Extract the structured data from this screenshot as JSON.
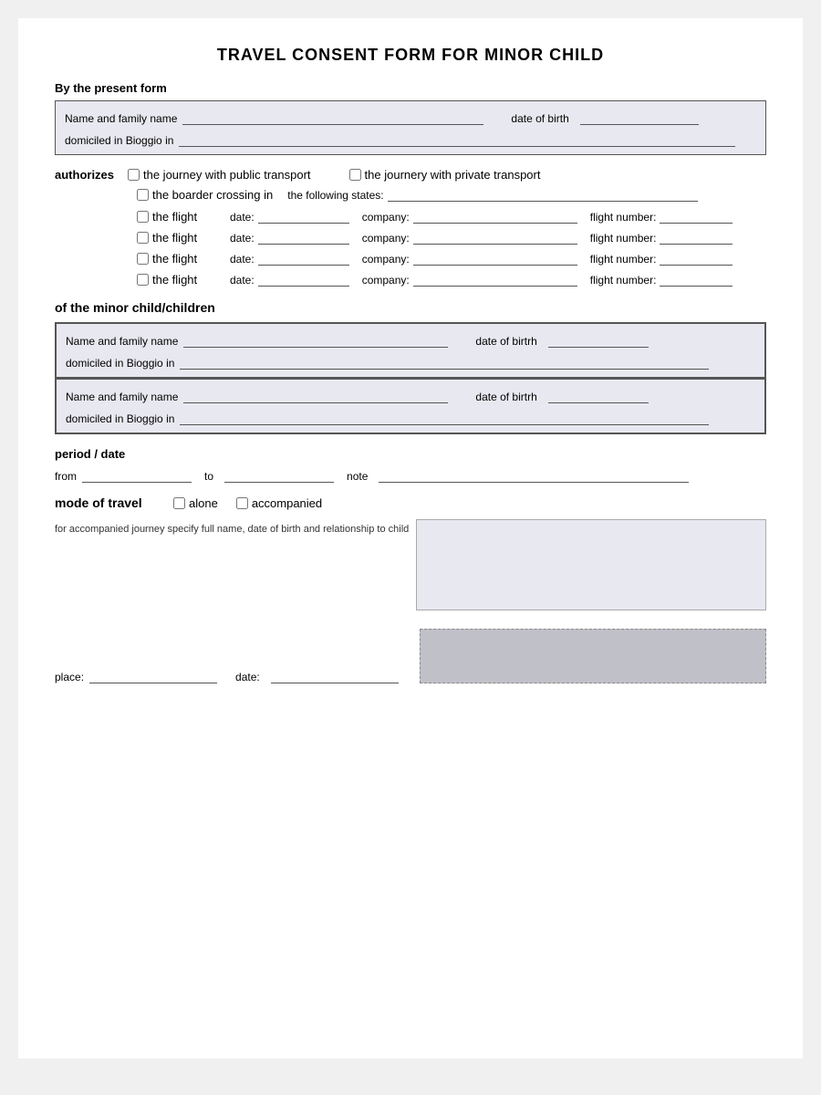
{
  "title": "TRAVEL CONSENT FORM FOR MINOR CHILD",
  "by_present_form": "By the present form",
  "parent_fields": {
    "name_label": "Name and family name",
    "dob_label": "date of birth",
    "domicile_label": "domiciled in Bioggio in"
  },
  "authorizes": {
    "label": "authorizes",
    "transport_options": [
      {
        "id": "pub",
        "label": "the journey with public transport"
      },
      {
        "id": "priv",
        "label": "the journery with private transport"
      }
    ],
    "border_label": "the boarder crossing in",
    "border_sub": "the following states:",
    "flights": [
      {
        "label": "the flight",
        "date_label": "date:",
        "company_label": "company:",
        "flight_label": "flight number:"
      },
      {
        "label": "the flight",
        "date_label": "date:",
        "company_label": "company:",
        "flight_label": "flight number:"
      },
      {
        "label": "the flight",
        "date_label": "date:",
        "company_label": "company:",
        "flight_label": "flight number:"
      },
      {
        "label": "the flight",
        "date_label": "date:",
        "company_label": "company:",
        "flight_label": "flight number:"
      }
    ]
  },
  "minor_section": {
    "heading": "of the minor child/children",
    "children": [
      {
        "name_label": "Name and family name",
        "dob_label": "date of birtrh",
        "domicile_label": "domiciled in Bioggio in"
      },
      {
        "name_label": "Name and family name",
        "dob_label": "date of birtrh",
        "domicile_label": "domiciled in Bioggio in"
      }
    ]
  },
  "period": {
    "heading": "period / date",
    "from_label": "from",
    "to_label": "to",
    "note_label": "note"
  },
  "mode_of_travel": {
    "label": "mode of travel",
    "options": [
      {
        "id": "alone",
        "label": "alone"
      },
      {
        "id": "accompanied",
        "label": "accompanied"
      }
    ],
    "textarea_desc": "for accompanied journey specify full name, date of birth and relationship to child"
  },
  "bottom": {
    "place_label": "place:",
    "date_label": "date:"
  }
}
